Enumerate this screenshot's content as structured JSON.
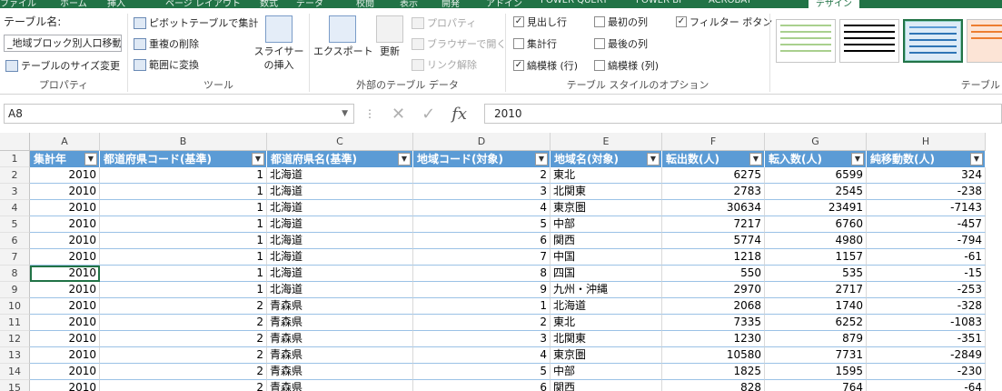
{
  "tabs": [
    "ファイル",
    "ホーム",
    "挿入",
    "ページ レイアウト",
    "数式",
    "データ",
    "校閲",
    "表示",
    "開発",
    "アドイン",
    "POWER QUERY",
    "POWER BI",
    "ACROBAT",
    "デザイン"
  ],
  "ribbon": {
    "properties": {
      "title": "テーブル名:",
      "table_name": "_地域ブロック別人口移動",
      "resize": "テーブルのサイズ変更",
      "label": "プロパティ"
    },
    "tools": {
      "pivot": "ピボットテーブルで集計",
      "dedupe": "重複の削除",
      "convert": "範囲に変換",
      "slicer": "スライサーの挿入",
      "label": "ツール"
    },
    "external": {
      "export": "エクスポート",
      "refresh": "更新",
      "props": "プロパティ",
      "browser": "ブラウザーで開く",
      "unlink": "リンク解除",
      "label": "外部のテーブル データ"
    },
    "options": {
      "header_row": "見出し行",
      "total_row": "集計行",
      "banded_rows": "縞模様 (行)",
      "first_col": "最初の列",
      "last_col": "最後の列",
      "banded_cols": "縞模様 (列)",
      "filter_btn": "フィルター ボタン",
      "label": "テーブル スタイルのオプション",
      "header_checked": true,
      "total_checked": false,
      "banded_rows_checked": true,
      "first_checked": false,
      "last_checked": false,
      "banded_cols_checked": false,
      "filter_checked": true
    },
    "styles": {
      "label": "テーブル"
    }
  },
  "namebox": "A8",
  "formula": "2010",
  "columns": [
    "A",
    "B",
    "C",
    "D",
    "E",
    "F",
    "G",
    "H"
  ],
  "headers": [
    "集計年",
    "都道府県コード(基準)",
    "都道府県名(基準)",
    "地域コード(対象)",
    "地域名(対象)",
    "転出数(人)",
    "転入数(人)",
    "純移動数(人)"
  ],
  "rows": [
    [
      "2010",
      "1",
      "北海道",
      "2",
      "東北",
      "6275",
      "6599",
      "324"
    ],
    [
      "2010",
      "1",
      "北海道",
      "3",
      "北関東",
      "2783",
      "2545",
      "-238"
    ],
    [
      "2010",
      "1",
      "北海道",
      "4",
      "東京圏",
      "30634",
      "23491",
      "-7143"
    ],
    [
      "2010",
      "1",
      "北海道",
      "5",
      "中部",
      "7217",
      "6760",
      "-457"
    ],
    [
      "2010",
      "1",
      "北海道",
      "6",
      "関西",
      "5774",
      "4980",
      "-794"
    ],
    [
      "2010",
      "1",
      "北海道",
      "7",
      "中国",
      "1218",
      "1157",
      "-61"
    ],
    [
      "2010",
      "1",
      "北海道",
      "8",
      "四国",
      "550",
      "535",
      "-15"
    ],
    [
      "2010",
      "1",
      "北海道",
      "9",
      "九州・沖縄",
      "2970",
      "2717",
      "-253"
    ],
    [
      "2010",
      "2",
      "青森県",
      "1",
      "北海道",
      "2068",
      "1740",
      "-328"
    ],
    [
      "2010",
      "2",
      "青森県",
      "2",
      "東北",
      "7335",
      "6252",
      "-1083"
    ],
    [
      "2010",
      "2",
      "青森県",
      "3",
      "北関東",
      "1230",
      "879",
      "-351"
    ],
    [
      "2010",
      "2",
      "青森県",
      "4",
      "東京圏",
      "10580",
      "7731",
      "-2849"
    ],
    [
      "2010",
      "2",
      "青森県",
      "5",
      "中部",
      "1825",
      "1595",
      "-230"
    ],
    [
      "2010",
      "2",
      "青森県",
      "6",
      "関西",
      "828",
      "764",
      "-64"
    ]
  ],
  "row_numbers": [
    "1",
    "2",
    "3",
    "4",
    "5",
    "6",
    "7",
    "8",
    "9",
    "10",
    "11",
    "12",
    "13",
    "14",
    "15"
  ],
  "colors": {
    "accent": "#217346",
    "table_header": "#5b9bd5",
    "band_border": "#9bc2e6"
  }
}
